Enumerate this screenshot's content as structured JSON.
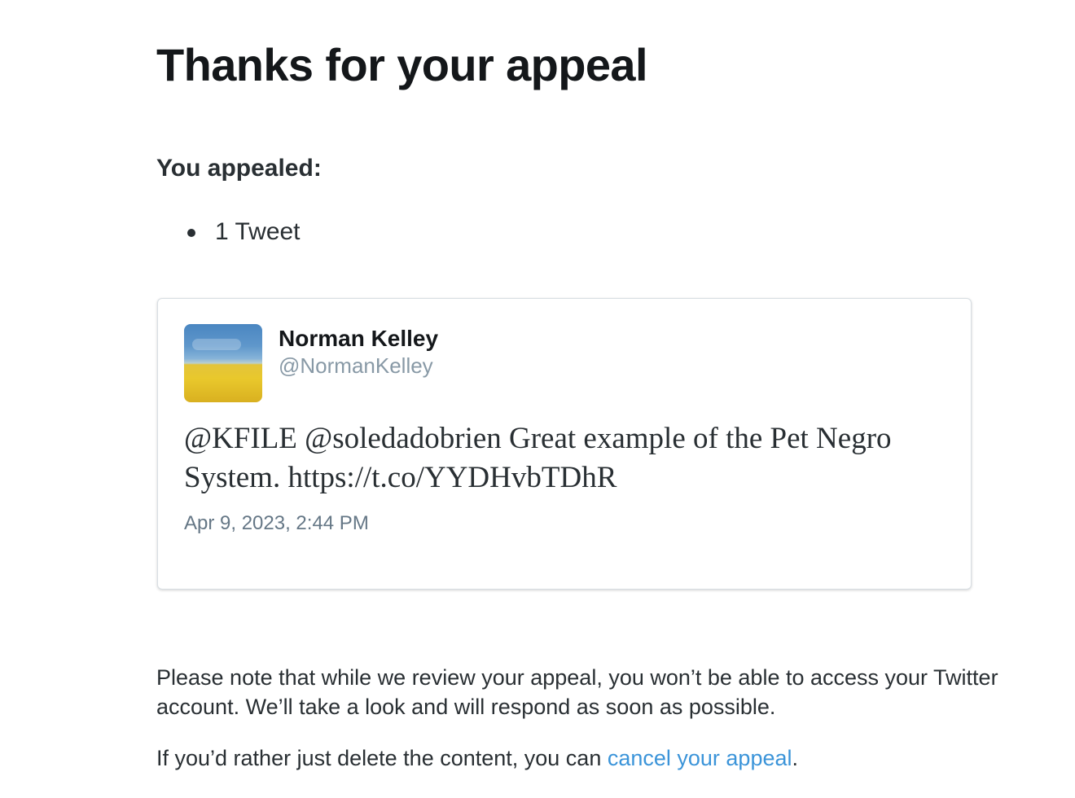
{
  "page": {
    "title": "Thanks for your appeal",
    "subhead": "You appealed:",
    "appealed_items": [
      "1 Tweet"
    ]
  },
  "tweet": {
    "author_name": "Norman Kelley",
    "author_handle": "@NormanKelley",
    "text": "@KFILE @soledadobrien Great example of the Pet Negro System. https://t.co/YYDHvbTDhR",
    "timestamp": "Apr 9, 2023, 2:44 PM",
    "avatar_icon": "profile-photo-blue-sky-yellow-field"
  },
  "notice": {
    "review_note": "Please note that while we review your appeal, you won’t be able to access your Twitter account. We’ll take a look and will respond as soon as possible.",
    "cancel_prefix": "If you’d rather just delete the content, you can ",
    "cancel_link": "cancel your appeal",
    "cancel_suffix": "."
  },
  "colors": {
    "link": "#3b94d9",
    "text": "#292f33",
    "muted": "#8899a6"
  }
}
